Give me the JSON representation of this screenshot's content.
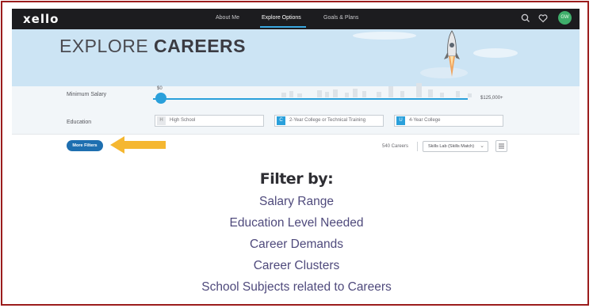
{
  "app": {
    "logo": "xello"
  },
  "nav": {
    "links": [
      "About Me",
      "Explore Options",
      "Goals & Plans"
    ],
    "active": "Explore Options",
    "avatar_text": "GW"
  },
  "hero": {
    "title_light": "EXPLORE ",
    "title_bold": "CAREERS"
  },
  "filters": {
    "salary_label": "Minimum Salary",
    "salary_min": "$0",
    "salary_max": "$125,000+",
    "education_label": "Education",
    "education_options": [
      {
        "badge": "H",
        "label": "High School"
      },
      {
        "badge": "C",
        "label": "2-Year College or Technical Training"
      },
      {
        "badge": "U",
        "label": "4-Year College"
      }
    ],
    "more_filters_label": "More Filters"
  },
  "results": {
    "count_text": "540 Careers",
    "sort_selected": "Skills Lab (Skills Match)"
  },
  "annotation": {
    "heading": "Filter by:",
    "items": [
      "Salary Range",
      "Education Level Needed",
      "Career Demands",
      "Career Clusters",
      "School Subjects related to Careers"
    ]
  },
  "colors": {
    "nav_bg": "#1c1c1f",
    "accent": "#2aa0db",
    "button": "#1e6fb0",
    "arrow": "#f5b731",
    "frame": "#9b1c1c",
    "list_text": "#4f4a7c"
  },
  "icons": [
    "search-icon",
    "heart-icon",
    "rocket-illustration",
    "arrow-annotation",
    "list-view-icon",
    "chevron-down-icon"
  ]
}
